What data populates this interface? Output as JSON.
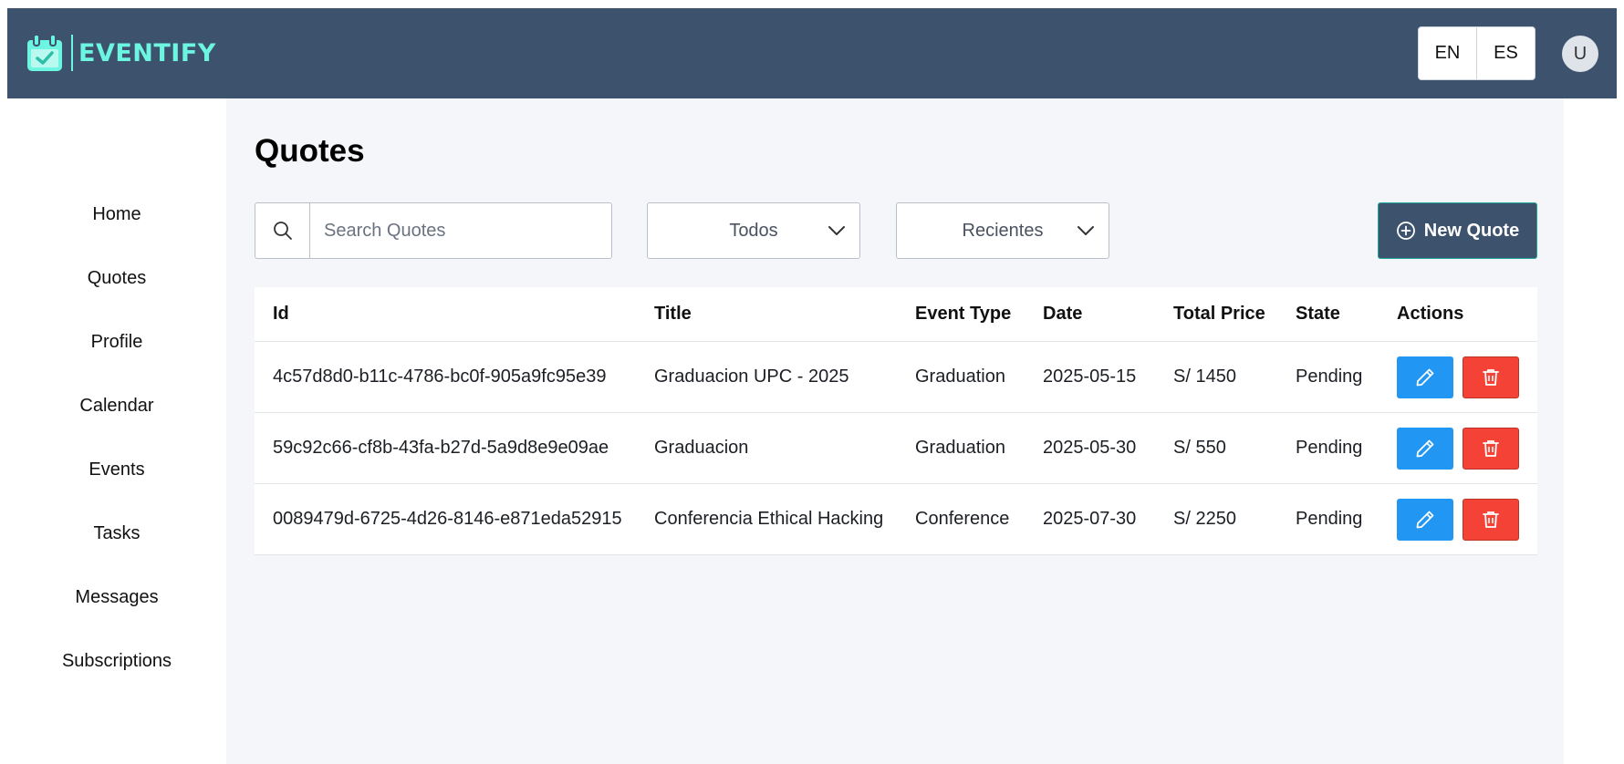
{
  "app": {
    "name": "EVENTIFY"
  },
  "header": {
    "languages": [
      "EN",
      "ES"
    ],
    "avatar_initial": "U"
  },
  "sidebar": {
    "items": [
      {
        "label": "Home"
      },
      {
        "label": "Quotes"
      },
      {
        "label": "Profile"
      },
      {
        "label": "Calendar"
      },
      {
        "label": "Events"
      },
      {
        "label": "Tasks"
      },
      {
        "label": "Messages"
      },
      {
        "label": "Subscriptions"
      }
    ]
  },
  "page": {
    "title": "Quotes"
  },
  "toolbar": {
    "search_placeholder": "Search Quotes",
    "search_value": "",
    "filter_selected": "Todos",
    "sort_selected": "Recientes",
    "new_quote_label": "New Quote"
  },
  "table": {
    "columns": [
      "Id",
      "Title",
      "Event Type",
      "Date",
      "Total Price",
      "State",
      "Actions"
    ],
    "rows": [
      {
        "id": "4c57d8d0-b11c-4786-bc0f-905a9fc95e39",
        "title": "Graduacion UPC - 2025",
        "event_type": "Graduation",
        "date": "2025-05-15",
        "total_price": "S/ 1450",
        "state": "Pending"
      },
      {
        "id": "59c92c66-cf8b-43fa-b27d-5a9d8e9e09ae",
        "title": "Graduacion",
        "event_type": "Graduation",
        "date": "2025-05-30",
        "total_price": "S/ 550",
        "state": "Pending"
      },
      {
        "id": "0089479d-6725-4d26-8146-e871eda52915",
        "title": "Conferencia Ethical Hacking",
        "event_type": "Conference",
        "date": "2025-07-30",
        "total_price": "S/ 2250",
        "state": "Pending"
      }
    ]
  },
  "colors": {
    "topbar": "#3d526d",
    "brand_accent": "#6cf5e0",
    "edit_button": "#2196f3",
    "delete_button": "#f44336",
    "main_background": "#f5f6fa"
  },
  "icons": {
    "logo": "calendar-check-icon",
    "search": "search-icon",
    "dropdown": "chevron-down-icon",
    "new": "plus-circle-icon",
    "edit": "pencil-icon",
    "delete": "trash-icon"
  }
}
